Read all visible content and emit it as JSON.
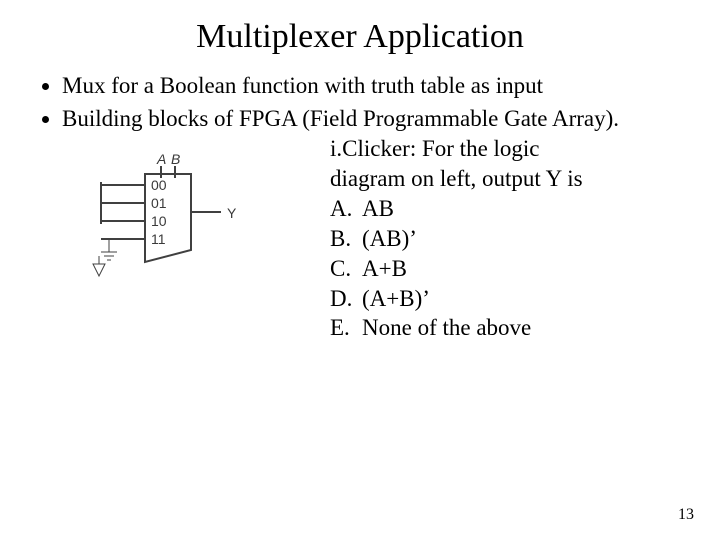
{
  "title": "Multiplexer Application",
  "bullets": [
    "Mux for a Boolean function with truth table as input",
    "Building blocks of FPGA (Field Programmable Gate Array)."
  ],
  "question": {
    "prompt_line1": "i.Clicker: For the logic",
    "prompt_line2": "diagram on left, output Y is",
    "options": [
      {
        "letter": "A.",
        "text": "AB"
      },
      {
        "letter": "B.",
        "text": "(AB)’"
      },
      {
        "letter": "C.",
        "text": "A+B"
      },
      {
        "letter": "D.",
        "text": "(A+B)’"
      },
      {
        "letter": "E.",
        "text": "None of the above"
      }
    ]
  },
  "diagram": {
    "select_label_a": "A",
    "select_label_b": "B",
    "input_labels": [
      "00",
      "01",
      "10",
      "11"
    ],
    "output_label": "Y"
  },
  "page_number": "13"
}
